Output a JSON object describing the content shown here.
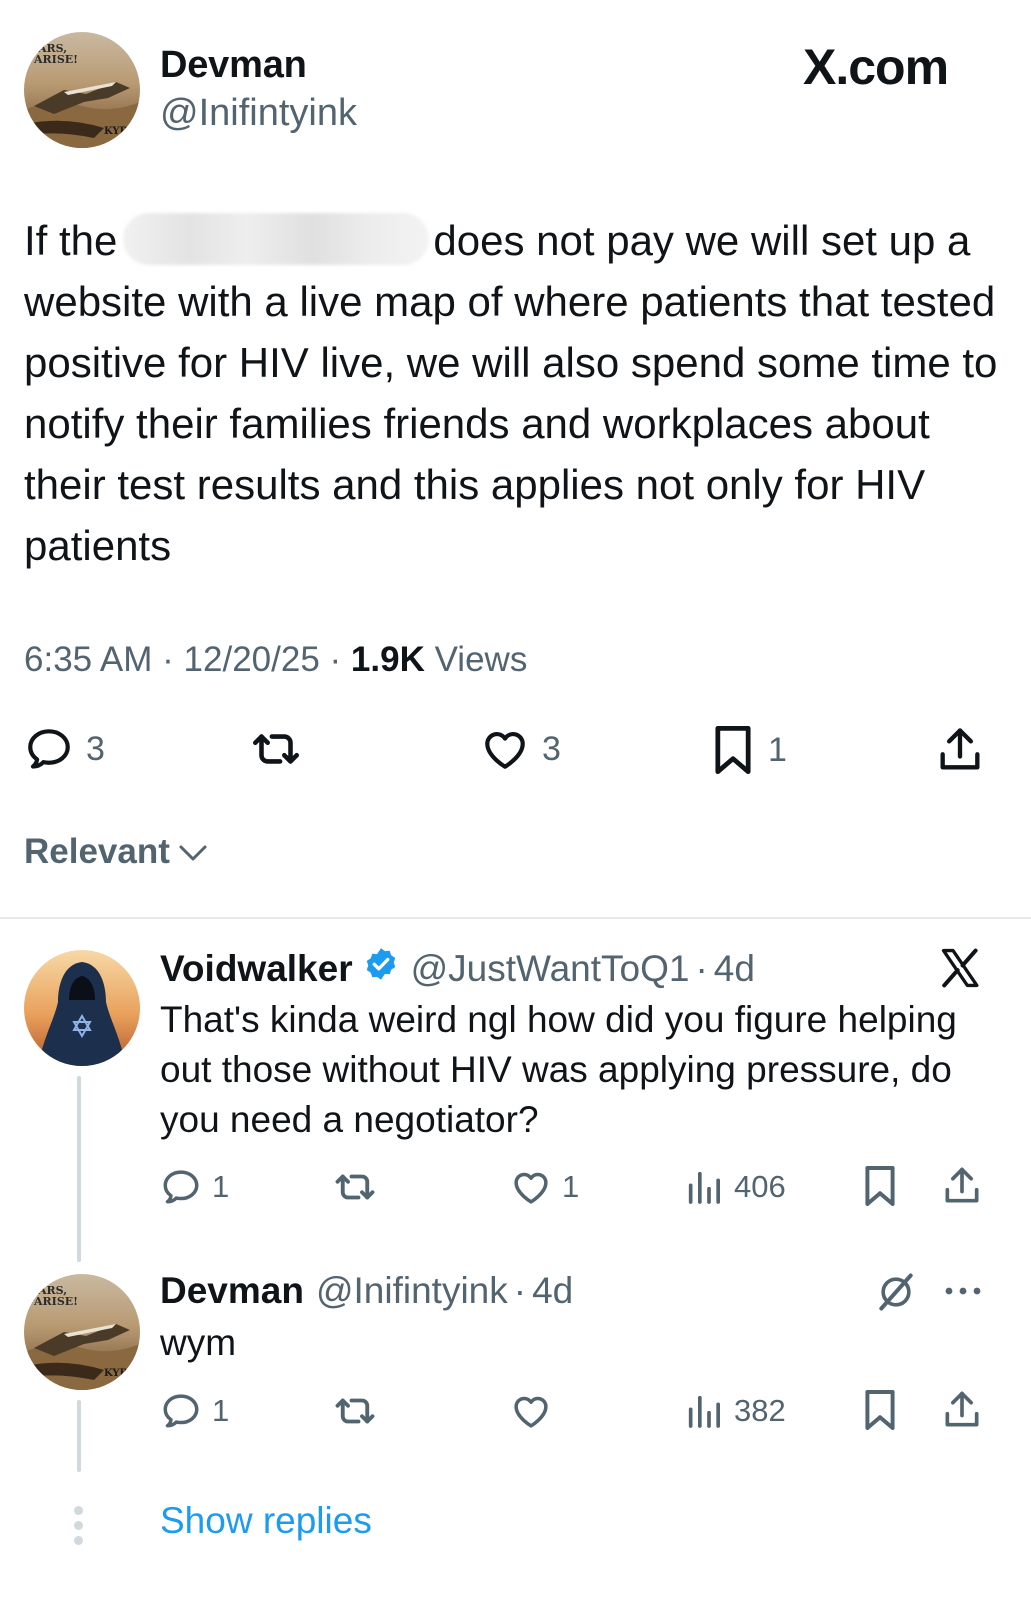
{
  "main_tweet": {
    "author": {
      "name": "Devman",
      "handle": "@Inifintyink",
      "avatar_text": "ARS, ARISE!",
      "avatar_mark": "KYB"
    },
    "brand": "X.com",
    "text_before": "If the",
    "text_after": "does not pay we will set up a website with a live map of where patients that tested positive for HIV live, we will also spend some time to notify their families friends and workplaces about their test results and this applies not only for HIV patients",
    "time": "6:35 AM",
    "date": "12/20/25",
    "views_count": "1.9K",
    "views_label": "Views",
    "separator": "·",
    "actions": {
      "replies": "3",
      "likes": "3",
      "bookmarks": "1"
    }
  },
  "sort": {
    "label": "Relevant"
  },
  "replies": [
    {
      "name": "Voidwalker",
      "handle": "@JustWantToQ1",
      "age": "4d",
      "verified": true,
      "text": "That's kinda weird ngl how did you figure helping out those without HIV was applying pressure, do you need a negotiator?",
      "actions": {
        "replies": "1",
        "likes": "1",
        "views": "406"
      }
    },
    {
      "name": "Devman",
      "handle": "@Inifintyink",
      "age": "4d",
      "verified": false,
      "avatar_text": "ARS, ARISE!",
      "avatar_mark": "KYB",
      "text": "wym",
      "actions": {
        "replies": "1",
        "likes": "",
        "views": "382"
      }
    }
  ],
  "show_replies": "Show replies",
  "colors": {
    "text": "#0f1419",
    "muted": "#536471",
    "link": "#1d9bf0",
    "verified": "#1d9bf0",
    "line": "#cfd9de"
  }
}
